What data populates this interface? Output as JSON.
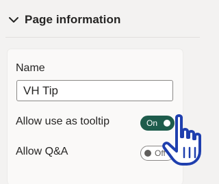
{
  "section": {
    "title": "Page information",
    "expanded_icon": "chevron-down-icon"
  },
  "card": {
    "name_label": "Name",
    "name_value": "VH Tip",
    "tooltip_label": "Allow use as tooltip",
    "tooltip_toggle": {
      "state": "On",
      "value": true
    },
    "qa_label": "Allow Q&A",
    "qa_toggle": {
      "state": "Off",
      "value": false
    }
  },
  "colors": {
    "toggle_on_bg": "#1e5c4c",
    "panel_bg": "#f3f2f1",
    "card_bg": "#faf9f8",
    "cursor_fill": "#ffffff",
    "cursor_outline": "#1f3fae"
  },
  "cursor": {
    "icon": "hand-pointer-cursor-icon"
  }
}
